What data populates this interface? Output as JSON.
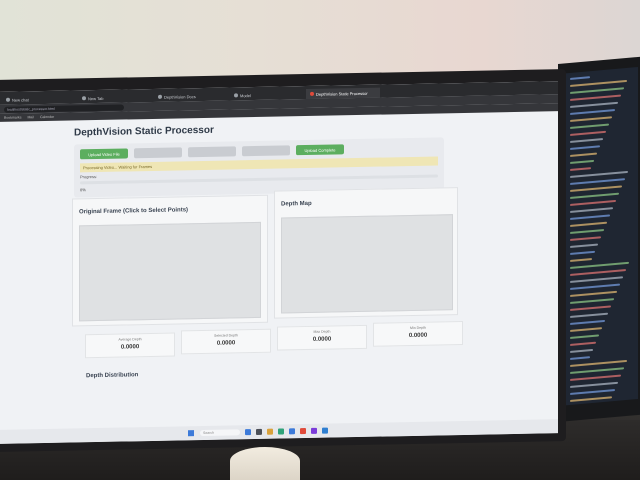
{
  "browser": {
    "tabs": [
      {
        "label": "New chat",
        "active": false
      },
      {
        "label": "New Tab",
        "active": false
      },
      {
        "label": "DepthVision Docs",
        "active": false
      },
      {
        "label": "Model",
        "active": false
      },
      {
        "label": "DepthVision Static Processor",
        "active": true
      }
    ],
    "address": "localhost/static_processor.html",
    "bookmarks": [
      "Bookmarks",
      "Mail",
      "Calendar"
    ]
  },
  "app": {
    "title": "DepthVision Static Processor",
    "buttons": [
      {
        "label": "Upload Video File",
        "style": "green"
      },
      {
        "label": "",
        "style": "grey"
      },
      {
        "label": "",
        "style": "grey"
      },
      {
        "label": "",
        "style": "grey"
      },
      {
        "label": "Upload Complete",
        "style": "green"
      }
    ],
    "status": "Processing Video... Waiting for Frames",
    "progress_label": "Progress:",
    "progress_value": 0,
    "progress_text": "0%",
    "original_title": "Original Frame (Click to Select Points)",
    "depth_title": "Depth Map",
    "metrics": [
      {
        "label": "Average Depth",
        "value": "0.0000"
      },
      {
        "label": "Selected Depth",
        "value": "0.0000"
      },
      {
        "label": "Max Depth",
        "value": "0.0000"
      },
      {
        "label": "Min Depth",
        "value": "0.0000"
      }
    ],
    "distribution_title": "Depth Distribution"
  },
  "taskbar": {
    "search_placeholder": "Search",
    "icon_colors": [
      "#3c7ad9",
      "#4b4f57",
      "#d9a23c",
      "#2fa37a",
      "#3c7ad9",
      "#e04a3a",
      "#7b3cd9",
      "#2f7fd1"
    ]
  },
  "colors": {
    "accent": "#5cae5f",
    "status_bg": "#efe6b5"
  }
}
